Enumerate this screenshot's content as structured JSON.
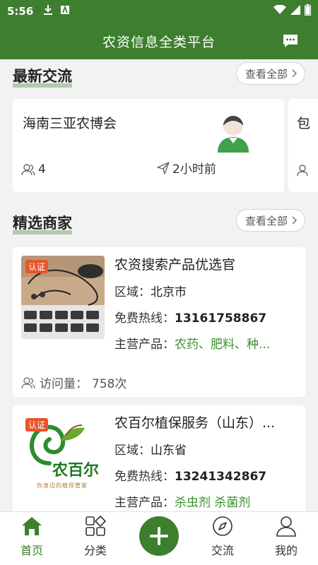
{
  "status_bar": {
    "time": "5:56"
  },
  "header": {
    "title": "农资信息全类平台"
  },
  "exchange": {
    "title": "最新交流",
    "see_all": "查看全部",
    "cards": [
      {
        "title": "海南三亚农博会",
        "members": "4",
        "time": "2小时前"
      },
      {
        "title": "包",
        "members": "",
        "time": ""
      }
    ]
  },
  "merchants": {
    "title": "精选商家",
    "see_all": "查看全部",
    "badge": "认证",
    "region_label": "区域：",
    "hotline_label": "免费热线：",
    "products_label": "主营产品：",
    "visits_label": "访问量：",
    "items": [
      {
        "name": "农资搜索产品优选官",
        "region": "北京市",
        "hotline": "13161758867",
        "products": "农药、肥料、种...",
        "visits": "758次"
      },
      {
        "name": "农百尔植保服务（山东）...",
        "region": "山东省",
        "hotline": "13241342867",
        "products": "杀虫剂 杀菌剂",
        "logo_text": "农百尔",
        "logo_slogan": "你身边的植保管家"
      }
    ]
  },
  "bottom_nav": [
    {
      "label": "首页",
      "icon": "home-icon",
      "active": true
    },
    {
      "label": "分类",
      "icon": "category-icon",
      "active": false
    },
    {
      "label": "",
      "icon": "plus-icon",
      "active": false
    },
    {
      "label": "交流",
      "icon": "compass-icon",
      "active": false
    },
    {
      "label": "我的",
      "icon": "user-icon",
      "active": false
    }
  ],
  "colors": {
    "brand_green": "#3d7f2f",
    "badge_orange": "#e8542b",
    "product_green": "#3d8f2f"
  }
}
